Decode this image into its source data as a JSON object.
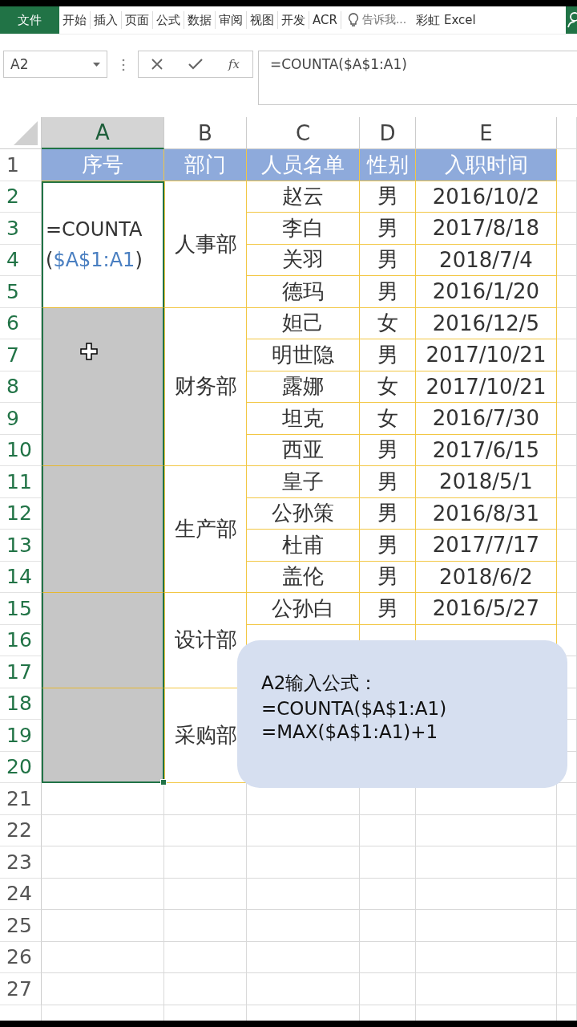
{
  "ribbon": {
    "tabs": [
      {
        "label": "文件",
        "kind": "file",
        "selected": false
      },
      {
        "label": "开始",
        "kind": "tab",
        "selected": false
      },
      {
        "label": "插入",
        "kind": "tab",
        "selected": false
      },
      {
        "label": "页面",
        "kind": "tab",
        "selected": false
      },
      {
        "label": "公式",
        "kind": "tab",
        "selected": false
      },
      {
        "label": "数据",
        "kind": "tab",
        "selected": false
      },
      {
        "label": "审阅",
        "kind": "tab",
        "selected": false
      },
      {
        "label": "视图",
        "kind": "tab",
        "selected": false
      },
      {
        "label": "开发",
        "kind": "tab",
        "selected": false
      },
      {
        "label": "ACR",
        "kind": "tab",
        "selected": false
      }
    ],
    "tell_me": "告诉我...",
    "account": "彩虹 Excel"
  },
  "formula_bar": {
    "name_box": "A2",
    "fx": "fx",
    "formula": "=COUNTA($A$1:A1)"
  },
  "columns": [
    {
      "label": "A",
      "selected": true
    },
    {
      "label": "B",
      "selected": false
    },
    {
      "label": "C",
      "selected": false
    },
    {
      "label": "D",
      "selected": false
    },
    {
      "label": "E",
      "selected": false
    }
  ],
  "row_headers": [
    {
      "label": "1",
      "selected": false
    },
    {
      "label": "2",
      "selected": true
    },
    {
      "label": "3",
      "selected": true
    },
    {
      "label": "4",
      "selected": true
    },
    {
      "label": "5",
      "selected": true
    },
    {
      "label": "6",
      "selected": true
    },
    {
      "label": "7",
      "selected": true
    },
    {
      "label": "8",
      "selected": true
    },
    {
      "label": "9",
      "selected": true
    },
    {
      "label": "10",
      "selected": true
    },
    {
      "label": "11",
      "selected": true
    },
    {
      "label": "12",
      "selected": true
    },
    {
      "label": "13",
      "selected": true
    },
    {
      "label": "14",
      "selected": true
    },
    {
      "label": "15",
      "selected": true
    },
    {
      "label": "16",
      "selected": true
    },
    {
      "label": "17",
      "selected": true
    },
    {
      "label": "18",
      "selected": true
    },
    {
      "label": "19",
      "selected": true
    },
    {
      "label": "20",
      "selected": true
    },
    {
      "label": "21",
      "selected": false
    },
    {
      "label": "22",
      "selected": false
    },
    {
      "label": "23",
      "selected": false
    },
    {
      "label": "24",
      "selected": false
    },
    {
      "label": "25",
      "selected": false
    },
    {
      "label": "26",
      "selected": false
    },
    {
      "label": "27",
      "selected": false
    }
  ],
  "table_header": [
    "序号",
    "部门",
    "人员名单",
    "性别",
    "入职时间"
  ],
  "departments": [
    {
      "name": "人事部",
      "editing": true,
      "staff": [
        {
          "kind": "person",
          "name": "赵云",
          "gender": "男",
          "date": "2016/10/2"
        },
        {
          "kind": "person",
          "name": "李白",
          "gender": "男",
          "date": "2017/8/18"
        },
        {
          "kind": "person",
          "name": "关羽",
          "gender": "男",
          "date": "2018/7/4"
        },
        {
          "kind": "person",
          "name": "德玛",
          "gender": "男",
          "date": "2016/1/20"
        }
      ]
    },
    {
      "name": "财务部",
      "editing": false,
      "staff": [
        {
          "kind": "person",
          "name": "妲己",
          "gender": "女",
          "date": "2016/12/5"
        },
        {
          "kind": "person",
          "name": "明世隐",
          "gender": "男",
          "date": "2017/10/21"
        },
        {
          "kind": "person",
          "name": "露娜",
          "gender": "女",
          "date": "2017/10/21"
        },
        {
          "kind": "person",
          "name": "坦克",
          "gender": "女",
          "date": "2016/7/30"
        },
        {
          "kind": "person",
          "name": "西亚",
          "gender": "男",
          "date": "2017/6/15"
        }
      ]
    },
    {
      "name": "生产部",
      "editing": false,
      "staff": [
        {
          "kind": "person",
          "name": "皇子",
          "gender": "男",
          "date": "2018/5/1"
        },
        {
          "kind": "person",
          "name": "公孙策",
          "gender": "男",
          "date": "2016/8/31"
        },
        {
          "kind": "person",
          "name": "杜甫",
          "gender": "男",
          "date": "2017/7/17"
        },
        {
          "kind": "person",
          "name": "盖伦",
          "gender": "男",
          "date": "2018/6/2"
        }
      ]
    },
    {
      "name": "设计部",
      "editing": false,
      "staff": [
        {
          "kind": "person",
          "name": "公孙白",
          "gender": "男",
          "date": "2016/5/27"
        },
        {
          "kind": "covered"
        },
        {
          "kind": "covered"
        }
      ]
    },
    {
      "name": "采购部",
      "editing": false,
      "staff": [
        {
          "kind": "covered"
        },
        {
          "kind": "covered"
        },
        {
          "kind": "covered"
        }
      ]
    }
  ],
  "editor": {
    "before": "=COUNTA(",
    "reference": "$A$1:A1",
    "after": ")"
  },
  "callout": {
    "lines": [
      "A2输入公式：",
      "=COUNTA($A$1:A1)",
      "=MAX($A$1:A1)+1"
    ]
  }
}
